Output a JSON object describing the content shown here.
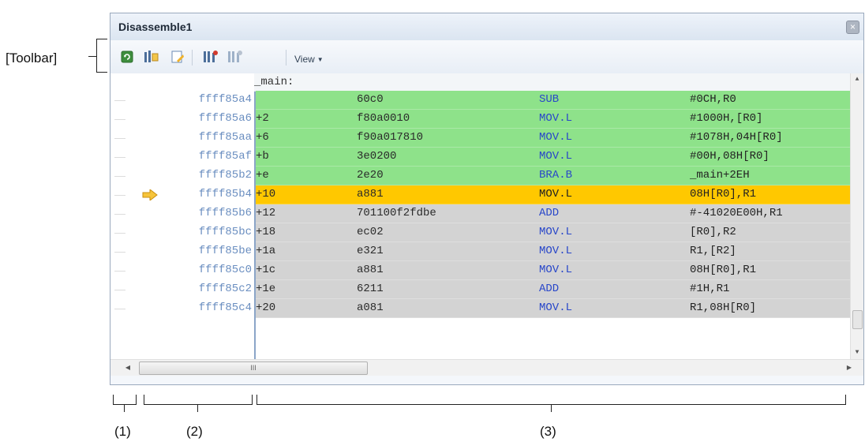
{
  "annotation": {
    "toolbar_label": "[Toolbar]",
    "areas": [
      "(1)",
      "(2)",
      "(3)"
    ]
  },
  "window": {
    "title": "Disassemble1",
    "close_icon": "close-icon"
  },
  "toolbar": {
    "buttons": [
      {
        "name": "refresh-button",
        "icon": "refresh-icon"
      },
      {
        "name": "go-to-pc-button",
        "icon": "go-to-icon"
      },
      {
        "name": "save-button",
        "icon": "save-icon"
      },
      {
        "name": "step-in-button",
        "icon": "step-in-icon"
      },
      {
        "name": "step-out-button",
        "icon": "step-out-icon"
      }
    ],
    "view_label": "View"
  },
  "disassembly": {
    "label": "_main:",
    "rows": [
      {
        "addr": "ffff85a4",
        "offset": "",
        "bytes": "60c0",
        "mnemonic": "SUB",
        "operands": "#0CH,R0",
        "state": "executed"
      },
      {
        "addr": "ffff85a6",
        "offset": "+2",
        "bytes": "f80a0010",
        "mnemonic": "MOV.L",
        "operands": "#1000H,[R0]",
        "state": "executed"
      },
      {
        "addr": "ffff85aa",
        "offset": "+6",
        "bytes": "f90a017810",
        "mnemonic": "MOV.L",
        "operands": "#1078H,04H[R0]",
        "state": "executed"
      },
      {
        "addr": "ffff85af",
        "offset": "+b",
        "bytes": "3e0200",
        "mnemonic": "MOV.L",
        "operands": "#00H,08H[R0]",
        "state": "executed"
      },
      {
        "addr": "ffff85b2",
        "offset": "+e",
        "bytes": "2e20",
        "mnemonic": "BRA.B",
        "operands": "_main+2EH",
        "state": "executed"
      },
      {
        "addr": "ffff85b4",
        "offset": "+10",
        "bytes": "a881",
        "mnemonic": "MOV.L",
        "operands": "08H[R0],R1",
        "state": "current"
      },
      {
        "addr": "ffff85b6",
        "offset": "+12",
        "bytes": "701100f2fdbe",
        "mnemonic": "ADD",
        "operands": "#-41020E00H,R1",
        "state": "pending"
      },
      {
        "addr": "ffff85bc",
        "offset": "+18",
        "bytes": "ec02",
        "mnemonic": "MOV.L",
        "operands": "[R0],R2",
        "state": "pending"
      },
      {
        "addr": "ffff85be",
        "offset": "+1a",
        "bytes": "e321",
        "mnemonic": "MOV.L",
        "operands": "R1,[R2]",
        "state": "pending"
      },
      {
        "addr": "ffff85c0",
        "offset": "+1c",
        "bytes": "a881",
        "mnemonic": "MOV.L",
        "operands": "08H[R0],R1",
        "state": "pending"
      },
      {
        "addr": "ffff85c2",
        "offset": "+1e",
        "bytes": "6211",
        "mnemonic": "ADD",
        "operands": "#1H,R1",
        "state": "pending"
      },
      {
        "addr": "ffff85c4",
        "offset": "+20",
        "bytes": "a081",
        "mnemonic": "MOV.L",
        "operands": "R1,08H[R0]",
        "state": "pending"
      }
    ]
  },
  "colors": {
    "executed": "#8ee28a",
    "current": "#ffc800",
    "pending": "#d3d3d3",
    "address": "#6a8ec0",
    "mnemonic": "#2947c9"
  },
  "scroll": {
    "h_thumb_grip": "III"
  }
}
